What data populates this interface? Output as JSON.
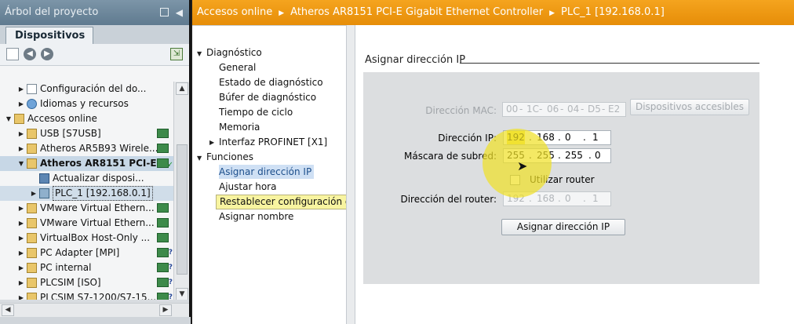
{
  "left_panel": {
    "title": "Árbol del proyecto",
    "tab": "Dispositivos",
    "tree": [
      {
        "label": "Configuración del do...",
        "icon": "config-sheet-icon",
        "indent": 1,
        "expanded": false
      },
      {
        "label": "Idiomas y recursos",
        "icon": "globe-icon",
        "indent": 1,
        "expanded": false
      },
      {
        "label": "Accesos online",
        "icon": "online-access-icon",
        "indent": 0,
        "expanded": true
      },
      {
        "label": "USB [S7USB]",
        "icon": "folder-icon",
        "indent": 1,
        "expanded": false,
        "status": "ok"
      },
      {
        "label": "Atheros AR5B93 Wirele...",
        "icon": "folder-icon",
        "indent": 1,
        "expanded": false,
        "status": "ok"
      },
      {
        "label": "Atheros AR8151 PCI-E ...",
        "icon": "folder-icon",
        "indent": 1,
        "expanded": true,
        "status": "connected",
        "bold": true
      },
      {
        "label": "Actualizar disposi...",
        "icon": "update-devices-icon",
        "indent": 2
      },
      {
        "label": "PLC_1 [192.168.0.1]",
        "icon": "plc-icon",
        "indent": 2,
        "expanded": false,
        "selected": true
      },
      {
        "label": "VMware Virtual Ethern...",
        "icon": "folder-icon",
        "indent": 1,
        "expanded": false,
        "status": "ok"
      },
      {
        "label": "VMware Virtual Ethern...",
        "icon": "folder-icon",
        "indent": 1,
        "expanded": false,
        "status": "ok"
      },
      {
        "label": "VirtualBox Host-Only ...",
        "icon": "folder-icon",
        "indent": 1,
        "expanded": false,
        "status": "ok"
      },
      {
        "label": "PC Adapter [MPI]",
        "icon": "folder-icon",
        "indent": 1,
        "expanded": false,
        "status": "unknown"
      },
      {
        "label": "PC internal",
        "icon": "folder-icon",
        "indent": 1,
        "expanded": false,
        "status": "unknown"
      },
      {
        "label": "PLCSIM [ISO]",
        "icon": "folder-icon",
        "indent": 1,
        "expanded": false,
        "status": "unknown"
      },
      {
        "label": "PLCSIM S7-1200/S7-15...",
        "icon": "folder-icon",
        "indent": 1,
        "expanded": false,
        "status": "unknown"
      }
    ]
  },
  "breadcrumb": {
    "items": [
      "Accesos online",
      "Atheros AR8151 PCI-E Gigabit Ethernet Controller",
      "PLC_1 [192.168.0.1]"
    ],
    "color": "#f0a020"
  },
  "nav": {
    "diagnostico": {
      "label": "Diagnóstico",
      "items": [
        "General",
        "Estado de diagnóstico",
        "Búfer de diagnóstico",
        "Tiempo de ciclo",
        "Memoria"
      ],
      "sub": "Interfaz PROFINET [X1]"
    },
    "funciones": {
      "label": "Funciones",
      "items": [
        "Asignar dirección IP",
        "Ajustar hora",
        "Restablecer configuración de fábrica",
        "Asignar nombre"
      ],
      "active": "Asignar dirección IP",
      "highlighted": "Restablecer configuración de fábrica"
    }
  },
  "assign_ip": {
    "section_title": "Asignar dirección IP",
    "mac_label": "Dirección MAC:",
    "mac": [
      "00",
      "1C",
      "06",
      "04",
      "D5",
      "E2"
    ],
    "devices_button": "Dispositivos accesibles",
    "ip_label": "Dirección IP:",
    "ip": [
      "192",
      "168",
      "0",
      "1"
    ],
    "mask_label": "Máscara de subred:",
    "mask": [
      "255",
      "255",
      "255",
      "0"
    ],
    "router_checkbox": "Utilizar router",
    "router_checked": false,
    "router_label": "Dirección del router:",
    "router": [
      "192",
      "168",
      "0",
      "1"
    ],
    "assign_button": "Asignar dirección IP",
    "separators": {
      "dot": ".",
      "dash": "-"
    }
  }
}
